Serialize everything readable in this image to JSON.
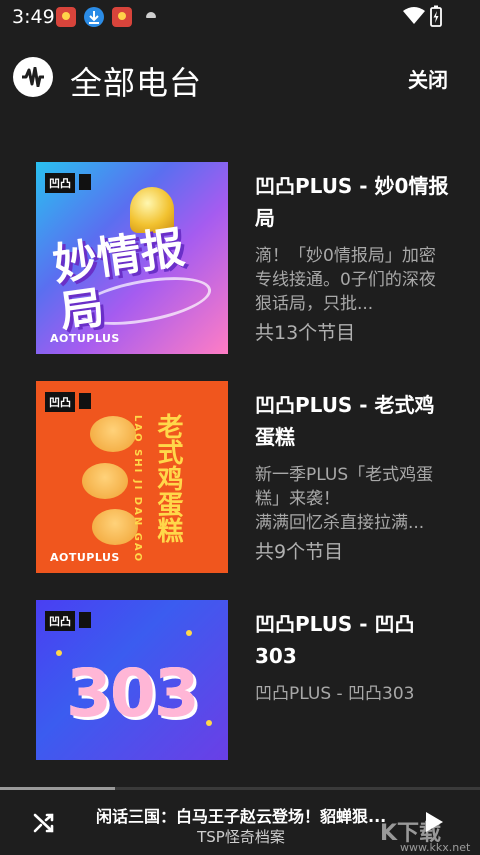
{
  "status_bar": {
    "time": "3:49"
  },
  "app_bar": {
    "title": "全部电台",
    "close_label": "关闭",
    "logo_icon": "waveform-icon"
  },
  "stations": [
    {
      "name": "凹凸PLUS - 妙0情报局",
      "description": "滴！「妙0情报局」加密专线接通。0子们的深夜狠话局，只批...",
      "count": "共13个节目",
      "cover": {
        "brand": "凹凸",
        "art_text": "妙情报局",
        "footer": "AOTUPLUS"
      }
    },
    {
      "name": "凹凸PLUS - 老式鸡蛋糕",
      "description": "新一季PLUS「老式鸡蛋糕」来袭！\n满满回忆杀直接拉满...",
      "count": "共9个节目",
      "cover": {
        "brand": "凹凸",
        "art_text": "老式鸡蛋糕",
        "art_subtext": "LAO SHI JI DAN GAO",
        "footer": "AOTUPLUS"
      }
    },
    {
      "name": "凹凸PLUS - 凹凸303",
      "description": "凹凸PLUS - 凹凸303",
      "count": "",
      "cover": {
        "brand": "凹凸",
        "art_text": "303"
      }
    }
  ],
  "player": {
    "track": "闲话三国：白马王子赵云登场！貂蝉狠...",
    "artist": "TSP怪奇档案",
    "progress": 0.24,
    "watermark": "K下载",
    "watermark_url": "www.kkx.net"
  },
  "colors": {
    "background": "#1e1e1e",
    "text_primary": "#ffffff",
    "text_secondary": "#a8a8a8"
  }
}
